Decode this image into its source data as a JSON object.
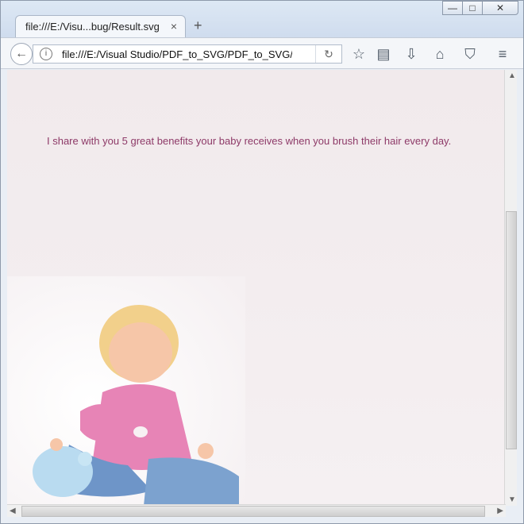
{
  "browser": {
    "tab_title": "file:///E:/Visu...bug/Result.svg",
    "tab_close": "×",
    "new_tab": "+",
    "url": "file:///E:/Visual Studio/PDF_to_SVG/PDF_to_SVG/bi",
    "window_buttons": {
      "minimize": "—",
      "maximize": "□",
      "close": "✕"
    },
    "icons": [
      "back-icon",
      "info-icon",
      "reload-icon",
      "bookmark-star-icon",
      "reader-icon",
      "download-icon",
      "home-icon",
      "pocket-icon",
      "menu-icon"
    ]
  },
  "content": {
    "text": "I share with you 5 great benefits your baby receives when you brush their hair every day."
  },
  "colors": {
    "text": "#8e3a68",
    "page_bg": "#f3eef0"
  }
}
